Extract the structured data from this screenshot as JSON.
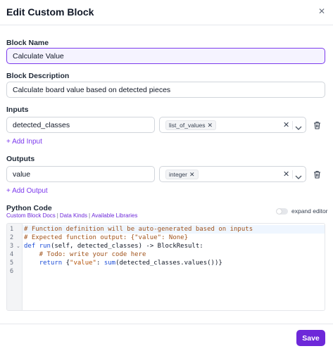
{
  "dialog": {
    "title": "Edit Custom Block"
  },
  "fields": {
    "block_name_label": "Block Name",
    "block_name_value": "Calculate Value",
    "block_description_label": "Block Description",
    "block_description_value": "Calculate board value based on detected pieces"
  },
  "inputs": {
    "label": "Inputs",
    "items": [
      {
        "name": "detected_classes",
        "kind": "list_of_values"
      }
    ],
    "add_label": "+ Add Input"
  },
  "outputs": {
    "label": "Outputs",
    "items": [
      {
        "name": "value",
        "kind": "integer"
      }
    ],
    "add_label": "+ Add Output"
  },
  "python": {
    "label": "Python Code",
    "links": [
      "Custom Block Docs",
      "Data Kinds",
      "Available Libraries"
    ],
    "expand_label": "expand editor",
    "expand_enabled": false,
    "line_numbers": [
      "1",
      "2",
      "3",
      "4",
      "5",
      "6"
    ],
    "code": [
      "# Function definition will be auto-generated based on inputs",
      "# Expected function output: {\"value\": None}",
      "def run(self, detected_classes) -> BlockResult:",
      "    # Todo: write your code here",
      "    return {\"value\": sum(detected_classes.values())}",
      ""
    ]
  },
  "footer": {
    "save_label": "Save"
  },
  "colors": {
    "accent": "#6d28d9",
    "link": "#7c3aed",
    "focus_bg": "#f5f3ff",
    "comment": "#a0521a",
    "keyword": "#1d4ed8"
  },
  "icons": {
    "close": "close-icon",
    "trash": "trash-icon",
    "chevron": "chevron-down-icon",
    "clear": "clear-icon"
  }
}
